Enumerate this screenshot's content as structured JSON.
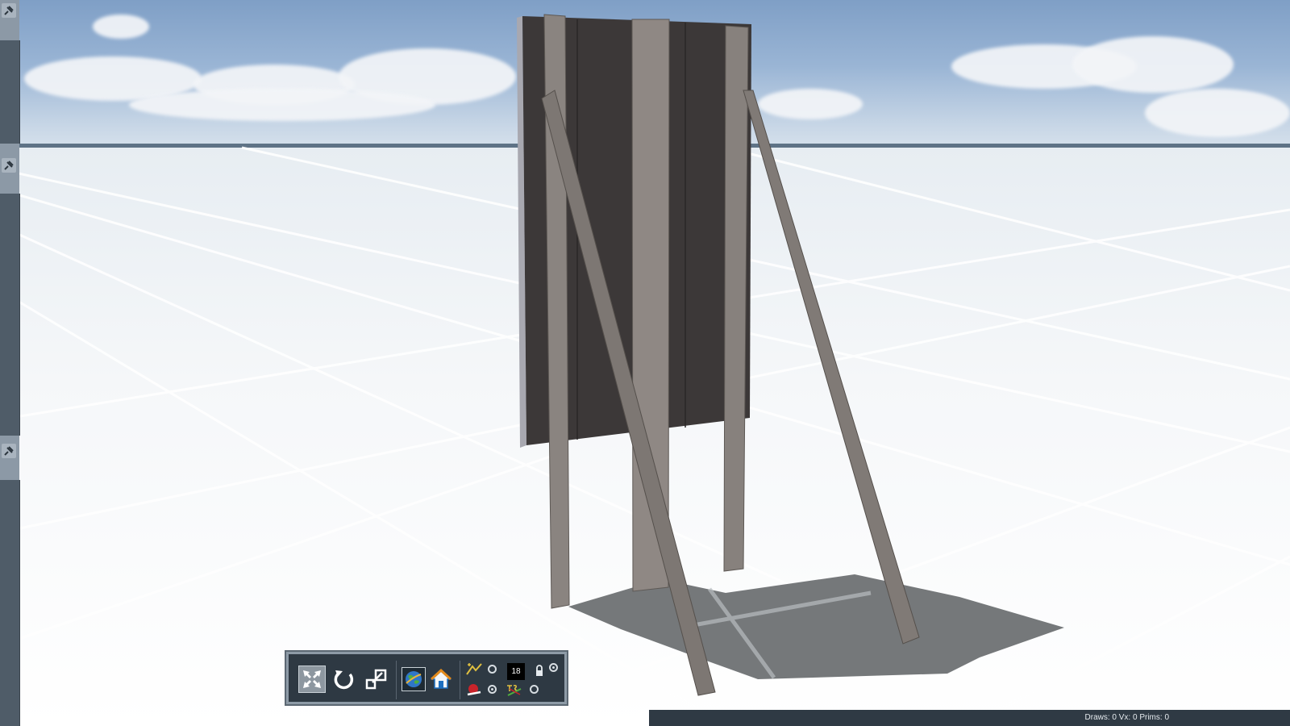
{
  "viewport": {
    "name": "3D viewport",
    "model": "wooden signboard with support posts",
    "colors": {
      "sky_top": "#7f9fc6",
      "ground": "#f5f7f9",
      "board": "#3c3838",
      "wood_post": "#8a8480"
    }
  },
  "left_dock": {
    "panels": [
      {
        "pin_icon": "pin-icon"
      },
      {
        "pin_icon": "pin-icon"
      },
      {
        "pin_icon": "pin-icon"
      }
    ]
  },
  "toolbar": {
    "buttons": [
      {
        "name": "move-tool",
        "icon": "move-arrows-icon",
        "active": true
      },
      {
        "name": "rotate-tool",
        "icon": "rotate-icon",
        "active": false
      },
      {
        "name": "scale-tool",
        "icon": "scale-icon",
        "active": false
      },
      {
        "name": "world-view",
        "icon": "globe-icon",
        "active": false
      },
      {
        "name": "home-view",
        "icon": "home-icon",
        "active": false
      }
    ],
    "snap_counter": "18",
    "small_tools": [
      {
        "name": "terrain-snap",
        "icon": "terrain-icon"
      },
      {
        "name": "ts-snap",
        "icon": "ts-icon"
      },
      {
        "name": "object-snap",
        "icon": "object-icon"
      },
      {
        "name": "lock",
        "icon": "lock-icon"
      }
    ]
  },
  "statusbar": {
    "stats": "Draws: 0 Vx: 0 Prims: 0"
  }
}
